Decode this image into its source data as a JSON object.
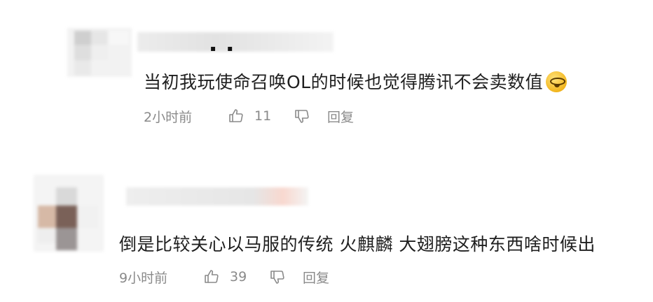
{
  "comments": [
    {
      "text": "当初我玩使命召唤OL的时候也觉得腾讯不会卖数值",
      "has_emoji": true,
      "time": "2小时前",
      "likes": "11",
      "reply_label": "回复"
    },
    {
      "text": "倒是比较关心以马服的传统 火麒麟 大翅膀这种东西啥时候出",
      "has_emoji": false,
      "time": "9小时前",
      "likes": "39",
      "reply_label": "回复"
    }
  ]
}
